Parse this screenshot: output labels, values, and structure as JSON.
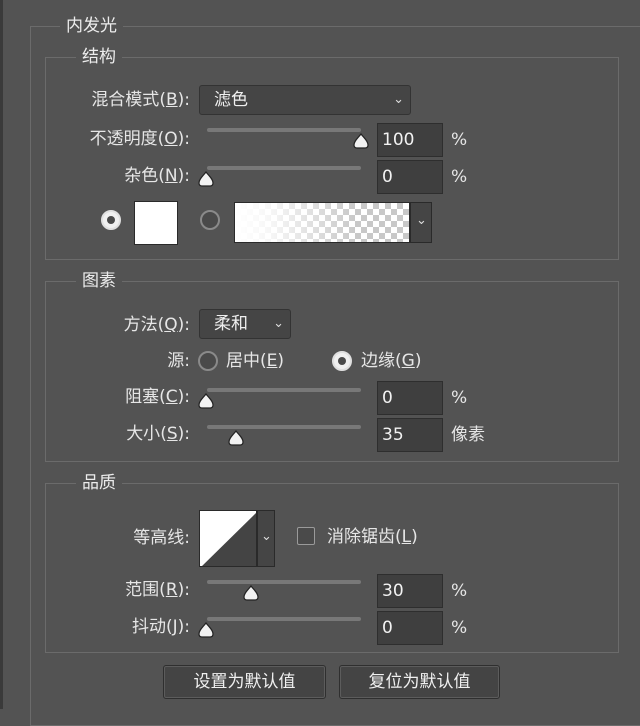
{
  "title": "内发光",
  "colors": {
    "panel_bg": "#535353",
    "field_bg": "#3f3f3f",
    "text": "#e6e6e6"
  },
  "structure": {
    "legend": "结构",
    "blend_mode": {
      "label": "混合模式",
      "key": "B",
      "value": "滤色"
    },
    "opacity": {
      "label": "不透明度",
      "key": "O",
      "value": "100",
      "unit": "%",
      "level": 1.0
    },
    "noise": {
      "label": "杂色",
      "key": "N",
      "value": "0",
      "unit": "%",
      "level": 0.0
    }
  },
  "elements": {
    "legend": "图素",
    "method": {
      "label": "方法",
      "key": "Q",
      "value": "柔和"
    },
    "source": {
      "label": "源",
      "center": {
        "label": "居中",
        "key": "E",
        "selected": false
      },
      "edge": {
        "label": "边缘",
        "key": "G",
        "selected": true
      }
    },
    "choke": {
      "label": "阻塞",
      "key": "C",
      "value": "0",
      "unit": "%",
      "level": 0.0
    },
    "size": {
      "label": "大小",
      "key": "S",
      "value": "35",
      "unit": "像素",
      "level": 0.2
    }
  },
  "quality": {
    "legend": "品质",
    "contour": {
      "label": "等高线"
    },
    "antialias": {
      "label": "消除锯齿",
      "key": "L",
      "checked": false
    },
    "range": {
      "label": "范围",
      "key": "R",
      "value": "30",
      "unit": "%",
      "level": 0.3
    },
    "jitter": {
      "label": "抖动",
      "key": "J",
      "value": "0",
      "unit": "%",
      "level": 0.0
    }
  },
  "buttons": {
    "make_default": "设置为默认值",
    "reset_default": "复位为默认值"
  }
}
